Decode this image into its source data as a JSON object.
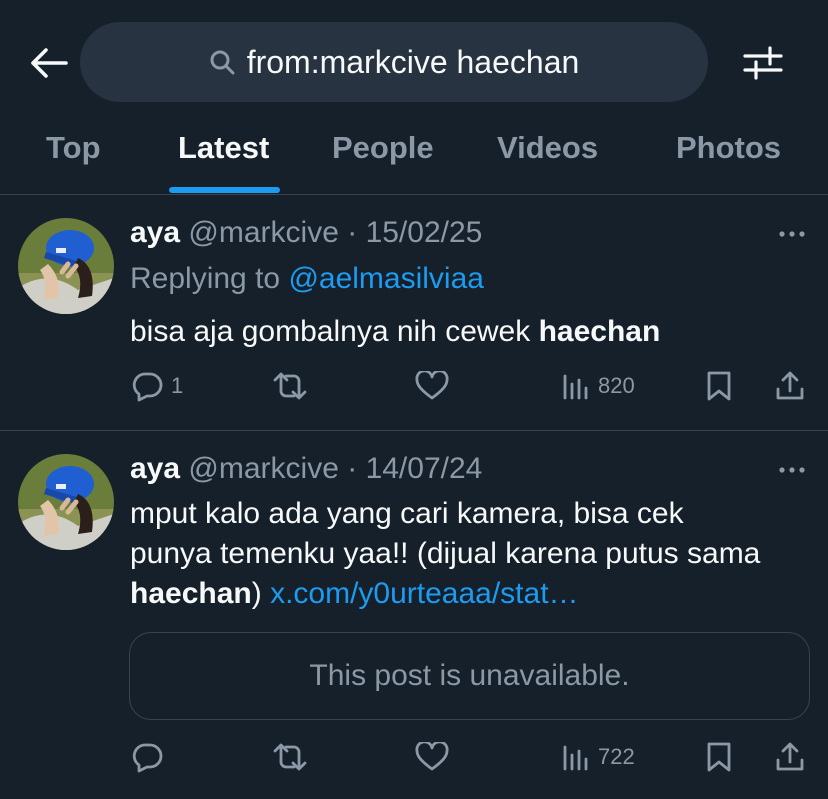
{
  "search": {
    "query": "from:markcive haechan"
  },
  "tabs": [
    {
      "label": "Top"
    },
    {
      "label": "Latest"
    },
    {
      "label": "People"
    },
    {
      "label": "Videos"
    },
    {
      "label": "Photos"
    }
  ],
  "active_tab": "Latest",
  "posts": [
    {
      "name": "aya",
      "handle": "@markcive",
      "separator": "·",
      "date": "15/02/25",
      "replying_prefix": "Replying to",
      "replying_to": "@aelmasilviaa",
      "text_before": "bisa aja gombalnya nih cewek",
      "text_bold": "haechan",
      "replies": "1",
      "views": "820"
    },
    {
      "name": "aya",
      "handle": "@markcive",
      "separator": "·",
      "date": "14/07/24",
      "line1": "mput kalo ada yang cari kamera, bisa cek",
      "line2": "punya temenku yaa!! (dijual karena putus sama",
      "line3_bold": "haechan",
      "line3_after": ")",
      "link": "x.com/y0urteaaa/stat…",
      "quoted_placeholder": "This post is unavailable.",
      "views": "722"
    }
  ],
  "icons": {
    "back": "arrow-left-icon",
    "search": "search-icon",
    "filter": "filter-sliders-icon",
    "more": "more-horizontal-icon",
    "reply": "reply-bubble-icon",
    "retweet": "retweet-icon",
    "like": "heart-icon",
    "views": "views-bars-icon",
    "bookmark": "bookmark-icon",
    "share": "share-icon"
  },
  "colors": {
    "background": "#15202b",
    "accent": "#1d9bf0",
    "muted": "#8b98a5",
    "divider": "#38444d",
    "search_bg": "#273340"
  }
}
